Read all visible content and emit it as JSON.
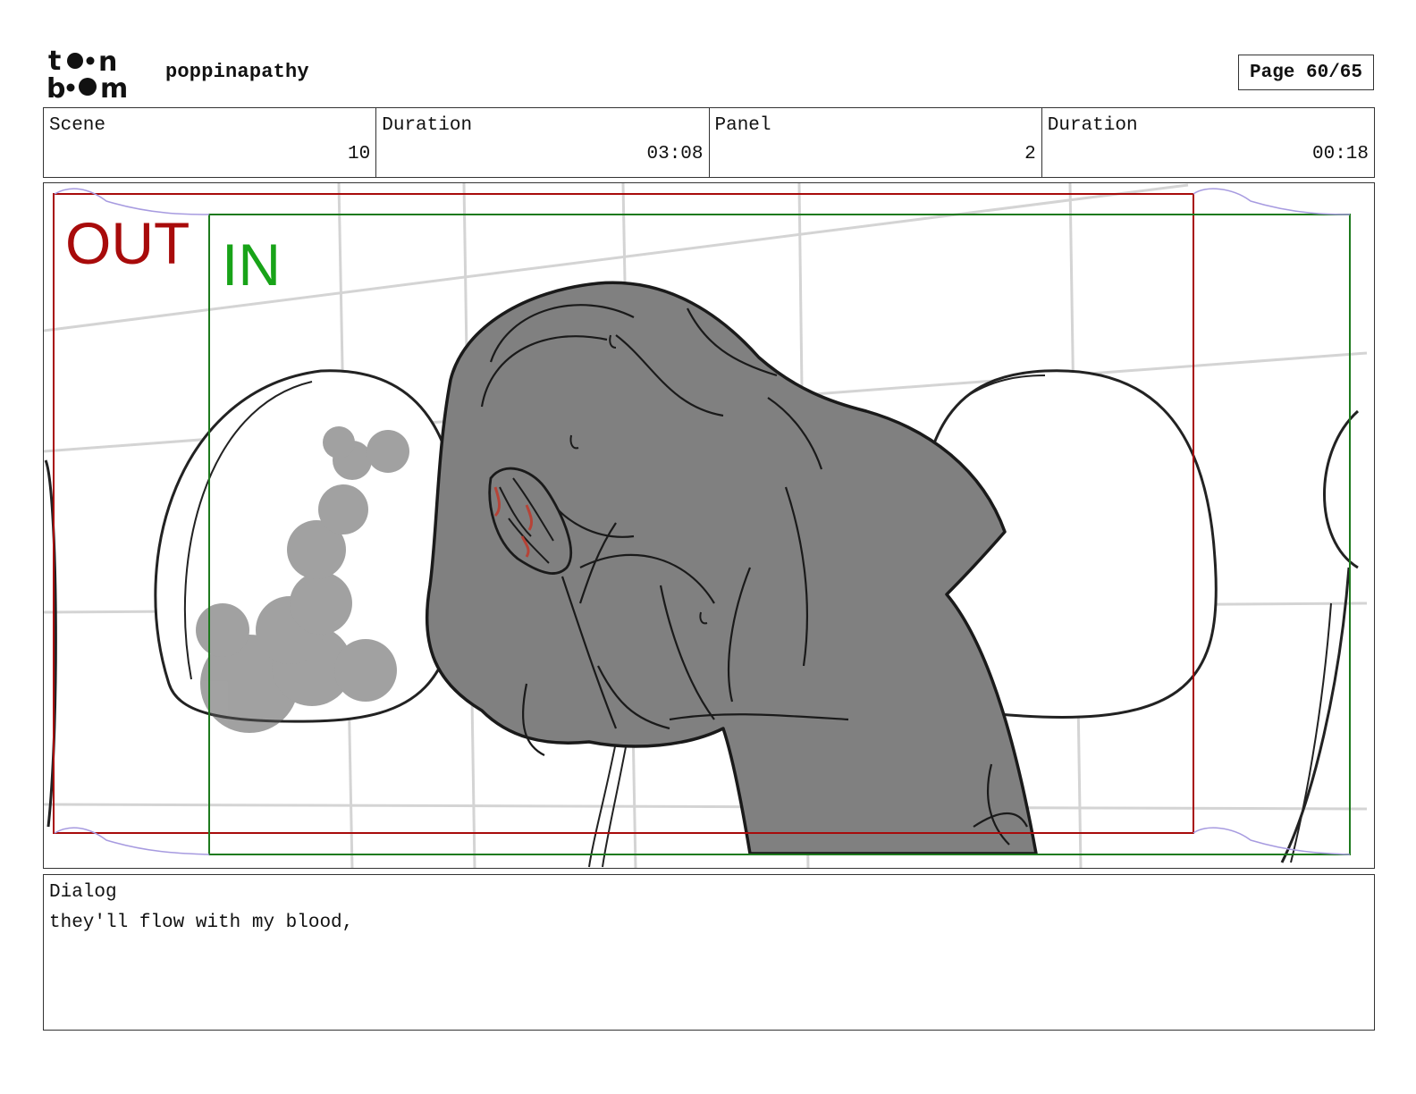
{
  "header": {
    "logo_text": "toon boom",
    "project_title": "poppinapathy",
    "page_indicator": "Page 60/65"
  },
  "info": {
    "scene_label": "Scene",
    "scene_value": "10",
    "scene_duration_label": "Duration",
    "scene_duration_value": "03:08",
    "panel_label": "Panel",
    "panel_value": "2",
    "panel_duration_label": "Duration",
    "panel_duration_value": "00:18"
  },
  "panel": {
    "out_label": "OUT",
    "in_label": "IN",
    "colors": {
      "out_frame": "#a80b0b",
      "in_frame": "#1e7a1e",
      "in_text": "#18a318",
      "character_fill": "#808080",
      "smoke": "#555555",
      "blood": "#c0392b"
    }
  },
  "dialog": {
    "label": "Dialog",
    "text": "they'll flow with my blood,"
  }
}
